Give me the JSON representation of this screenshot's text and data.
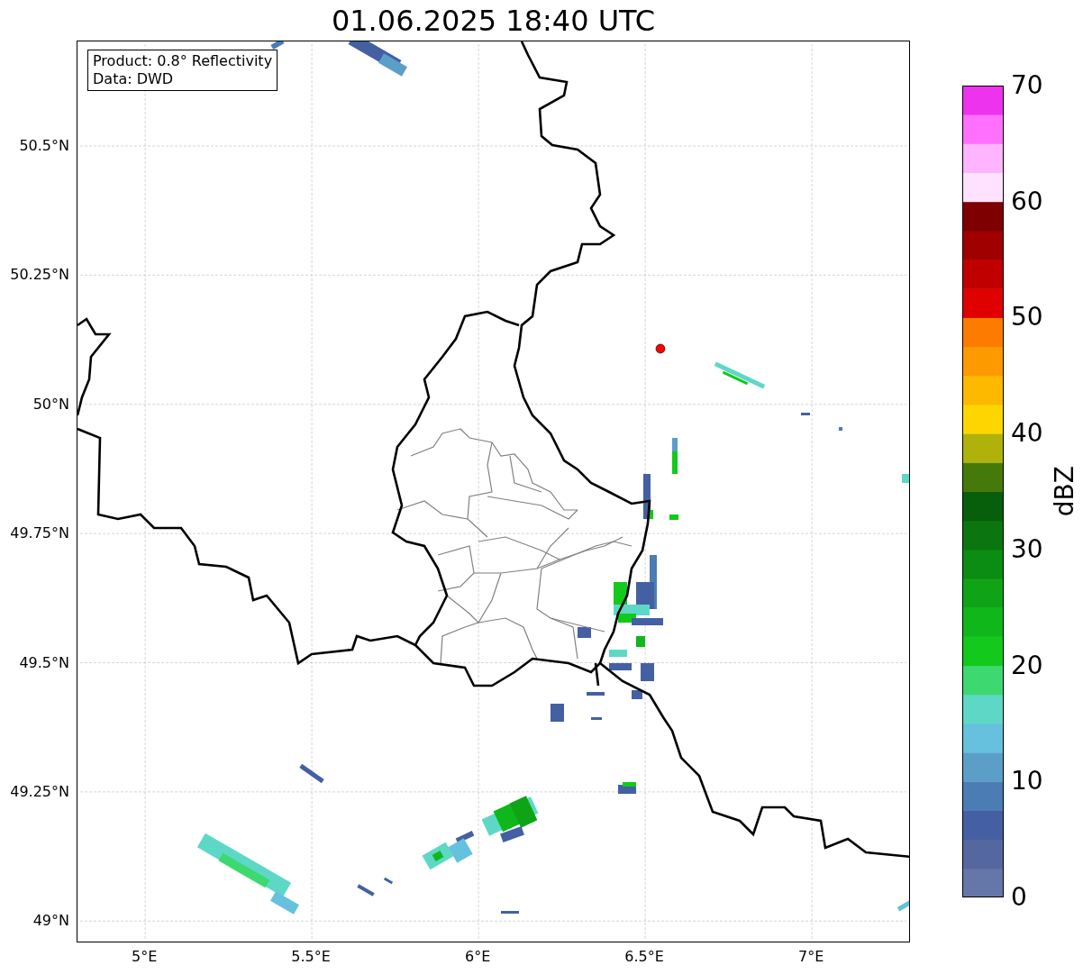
{
  "title": "01.06.2025 18:40 UTC",
  "info_box": [
    "Product: 0.8° Reflectivity",
    "Data: DWD"
  ],
  "x_ticks": [
    "5°E",
    "5.5°E",
    "6°E",
    "6.5°E",
    "7°E"
  ],
  "y_ticks": [
    "50.5°N",
    "50.25°N",
    "50°N",
    "49.75°N",
    "49.5°N",
    "49.25°N",
    "49°N"
  ],
  "colorbar": {
    "label": "dBZ",
    "ticks": [
      "70",
      "60",
      "50",
      "40",
      "30",
      "20",
      "10",
      "0"
    ]
  }
}
